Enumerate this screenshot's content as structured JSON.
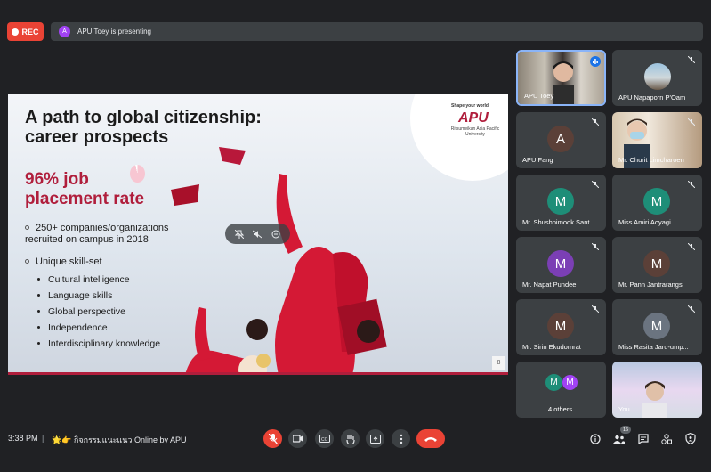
{
  "top": {
    "rec_label": "REC",
    "presenter_avatar": "A",
    "presenting_text": "APU Toey is presenting"
  },
  "slide": {
    "title": "A path to global citizenship: career prospects",
    "stat_line1": "96% job",
    "stat_line2": "placement rate",
    "stat_value_percent": 96,
    "bullets": [
      "250+ companies/organizations recruited on campus in 2018",
      "Unique skill-set"
    ],
    "skills": [
      "Cultural intelligence",
      "Language skills",
      "Global perspective",
      "Independence",
      "Interdisciplinary knowledge"
    ],
    "logo_tagline": "Shape your world",
    "logo_text": "APU",
    "logo_sub": "Ritsumeikan Asia Pacific University",
    "page_number": "8"
  },
  "participants": [
    {
      "name": "APU Toey",
      "initial": "",
      "color": "#6b6b6b",
      "kind": "video",
      "speaking": true
    },
    {
      "name": "APU Napaporn P'Oam",
      "initial": "",
      "color": "#8fb3c9",
      "kind": "avatar-photo"
    },
    {
      "name": "APU Fang",
      "initial": "A",
      "color": "#5b4038"
    },
    {
      "name": "Mr. Churit Limcharoen",
      "initial": "",
      "color": "#c9b8a6",
      "kind": "video"
    },
    {
      "name": "Mr. Shushpimook Sant...",
      "initial": "M",
      "color": "#1e8e78"
    },
    {
      "name": "Miss Amiri Aoyagi",
      "initial": "M",
      "color": "#1e8e78"
    },
    {
      "name": "Mr. Napat Pundee",
      "initial": "M",
      "color": "#7b3fb5"
    },
    {
      "name": "Mr. Pann Jantrarangsi",
      "initial": "M",
      "color": "#5b4038"
    },
    {
      "name": "Mr. Sirin Ekudomrat",
      "initial": "M",
      "color": "#5b4038"
    },
    {
      "name": "Miss Rasita Jaru-ump...",
      "initial": "M",
      "color": "#6b7480"
    },
    {
      "name": "4 others",
      "initial": "M",
      "color": "#1e8e78",
      "initial2": "M",
      "color2": "#a142f4"
    },
    {
      "name": "You",
      "initial": "",
      "color": "#c9d6e6",
      "kind": "video"
    }
  ],
  "bottom": {
    "time": "3:38 PM",
    "separator": "|",
    "meeting_title": "🌟👉 กิจกรรมแนะแนว Online by APU",
    "people_count": "16"
  },
  "colors": {
    "accent_red": "#ea4335",
    "slide_red": "#b01e3c",
    "tile_bg": "#3c4043",
    "page_bg": "#202124"
  }
}
